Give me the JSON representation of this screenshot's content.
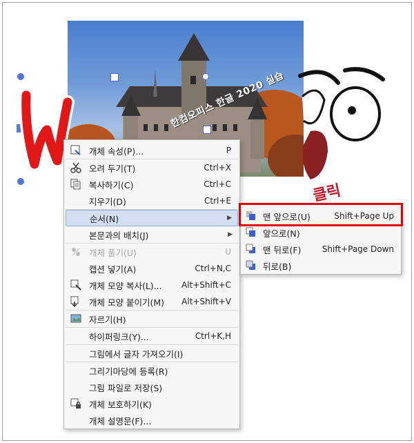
{
  "photo": {
    "caption": "한컴오피스 한글 2020 실습"
  },
  "context_menu": {
    "items": [
      {
        "label": "개체 속성(P)...",
        "shortcut": "P",
        "icon": "object-properties-icon"
      },
      {
        "label": "오려 두기(T)",
        "shortcut": "Ctrl+X",
        "icon": "scissors-icon"
      },
      {
        "label": "복사하기(C)",
        "shortcut": "Ctrl+C",
        "icon": "copy-icon"
      },
      {
        "label": "지우기(D)",
        "shortcut": "Ctrl+E",
        "icon": ""
      },
      {
        "label": "순서(N)",
        "shortcut": "",
        "icon": "",
        "submenu": true,
        "highlighted": true
      },
      {
        "label": "본문과의 배치(J)",
        "shortcut": "",
        "icon": "",
        "submenu": true
      },
      {
        "label": "개체 풀기(U)",
        "shortcut": "U",
        "icon": "ungroup-icon",
        "disabled": true
      },
      {
        "label": "캡션 넣기(A)",
        "shortcut": "Ctrl+N,C",
        "icon": ""
      },
      {
        "label": "개체 모양 복사(L)...",
        "shortcut": "Alt+Shift+C",
        "icon": "copy-shape-icon"
      },
      {
        "label": "개체 모양 붙이기(M)",
        "shortcut": "Alt+Shift+V",
        "icon": "paste-shape-icon"
      },
      {
        "label": "자르기(H)",
        "shortcut": "",
        "icon": "crop-icon"
      },
      {
        "label": "하이퍼링크(Y)...",
        "shortcut": "Ctrl+K,H",
        "icon": ""
      },
      {
        "label": "그림에서 글자 가져오기(I)",
        "shortcut": "",
        "icon": ""
      },
      {
        "label": "그리기마당에 등록(R)",
        "shortcut": "",
        "icon": ""
      },
      {
        "label": "그림 파일로 저장(S)",
        "shortcut": "",
        "icon": ""
      },
      {
        "label": "개체 보호하기(K)",
        "shortcut": "",
        "icon": "lock-icon"
      },
      {
        "label": "개체 설명문(F)...",
        "shortcut": "",
        "icon": ""
      }
    ]
  },
  "submenu": {
    "items": [
      {
        "label": "맨 앞으로(U)",
        "shortcut": "Shift+Page Up",
        "icon": "bring-to-front-icon"
      },
      {
        "label": "앞으로(N)",
        "shortcut": "",
        "icon": "bring-forward-icon"
      },
      {
        "label": "맨 뒤로(F)",
        "shortcut": "Shift+Page Down",
        "icon": "send-to-back-icon"
      },
      {
        "label": "뒤로(B)",
        "shortcut": "",
        "icon": "send-backward-icon"
      }
    ]
  },
  "annotation": {
    "click_text": "클릭",
    "highlight_color": "#e10000"
  }
}
